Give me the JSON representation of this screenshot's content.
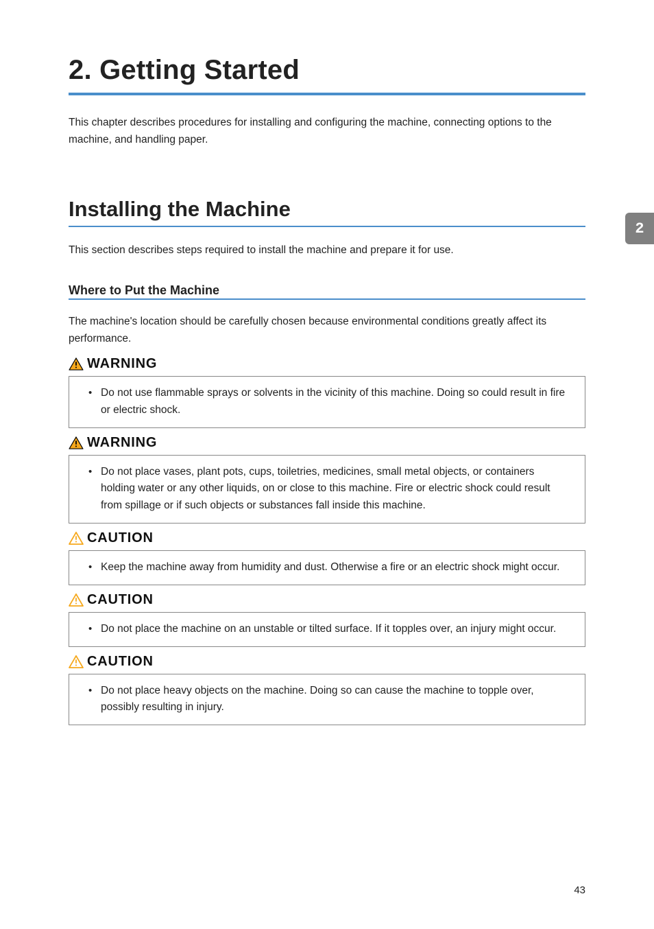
{
  "chapter": {
    "title": "2. Getting Started",
    "intro": "This chapter describes procedures for installing and configuring the machine, connecting options to the machine, and handling paper.",
    "tab_number": "2"
  },
  "section": {
    "title": "Installing the Machine",
    "intro": "This section describes steps required to install the machine and prepare it for use."
  },
  "subsection": {
    "title": "Where to Put the Machine",
    "intro": "The machine's location should be carefully chosen because environmental conditions greatly affect its performance."
  },
  "alerts": [
    {
      "level": "WARNING",
      "text": "Do not use flammable sprays or solvents in the vicinity of this machine. Doing so could result in fire or electric shock."
    },
    {
      "level": "WARNING",
      "text": "Do not place vases, plant pots, cups, toiletries, medicines, small metal objects, or containers holding water or any other liquids, on or close to this machine. Fire or electric shock could result from spillage or if such objects or substances fall inside this machine."
    },
    {
      "level": "CAUTION",
      "text": "Keep the machine away from humidity and dust. Otherwise a fire or an electric shock might occur."
    },
    {
      "level": "CAUTION",
      "text": "Do not place the machine on an unstable or tilted surface. If it topples over, an injury might occur."
    },
    {
      "level": "CAUTION",
      "text": "Do not place heavy objects on the machine. Doing so can cause the machine to topple over, possibly resulting in injury."
    }
  ],
  "page_number": "43",
  "colors": {
    "warning_fill": "#f6a81c",
    "caution_fill": "#f6a81c"
  }
}
